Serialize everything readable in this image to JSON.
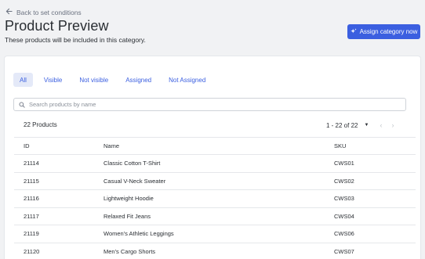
{
  "header": {
    "back_label": "Back to set conditions",
    "title": "Product Preview",
    "subtitle": "These products will be included in this category.",
    "assign_button_label": "Assign category now"
  },
  "tabs": [
    {
      "label": "All",
      "active": true
    },
    {
      "label": "Visible",
      "active": false
    },
    {
      "label": "Not visible",
      "active": false
    },
    {
      "label": "Assigned",
      "active": false
    },
    {
      "label": "Not Assigned",
      "active": false
    }
  ],
  "search": {
    "placeholder": "Search products by name",
    "value": ""
  },
  "summary": {
    "count_label": "22 Products",
    "range_label": "1 - 22 of 22"
  },
  "table": {
    "columns": [
      "ID",
      "Name",
      "SKU"
    ],
    "rows": [
      {
        "id": "21114",
        "name": "Classic Cotton T-Shirt",
        "sku": "CWS01"
      },
      {
        "id": "21115",
        "name": "Casual V-Neck Sweater",
        "sku": "CWS02"
      },
      {
        "id": "21116",
        "name": "Lightweight Hoodie",
        "sku": "CWS03"
      },
      {
        "id": "21117",
        "name": "Relaxed Fit Jeans",
        "sku": "CWS04"
      },
      {
        "id": "21119",
        "name": "Women's Athletic Leggings",
        "sku": "CWS06"
      },
      {
        "id": "21120",
        "name": "Men's Cargo Shorts",
        "sku": "CWS07"
      }
    ]
  },
  "icons": {
    "back": "arrow-left-icon",
    "assign": "sparkle-icon",
    "search": "search-icon",
    "dropdown": "caret-down-icon",
    "prev": "chevron-left-icon",
    "next": "chevron-right-icon"
  },
  "colors": {
    "accent": "#3b5fe0",
    "active_tab_bg": "#e4e9f8",
    "background": "#f1f2f4"
  }
}
